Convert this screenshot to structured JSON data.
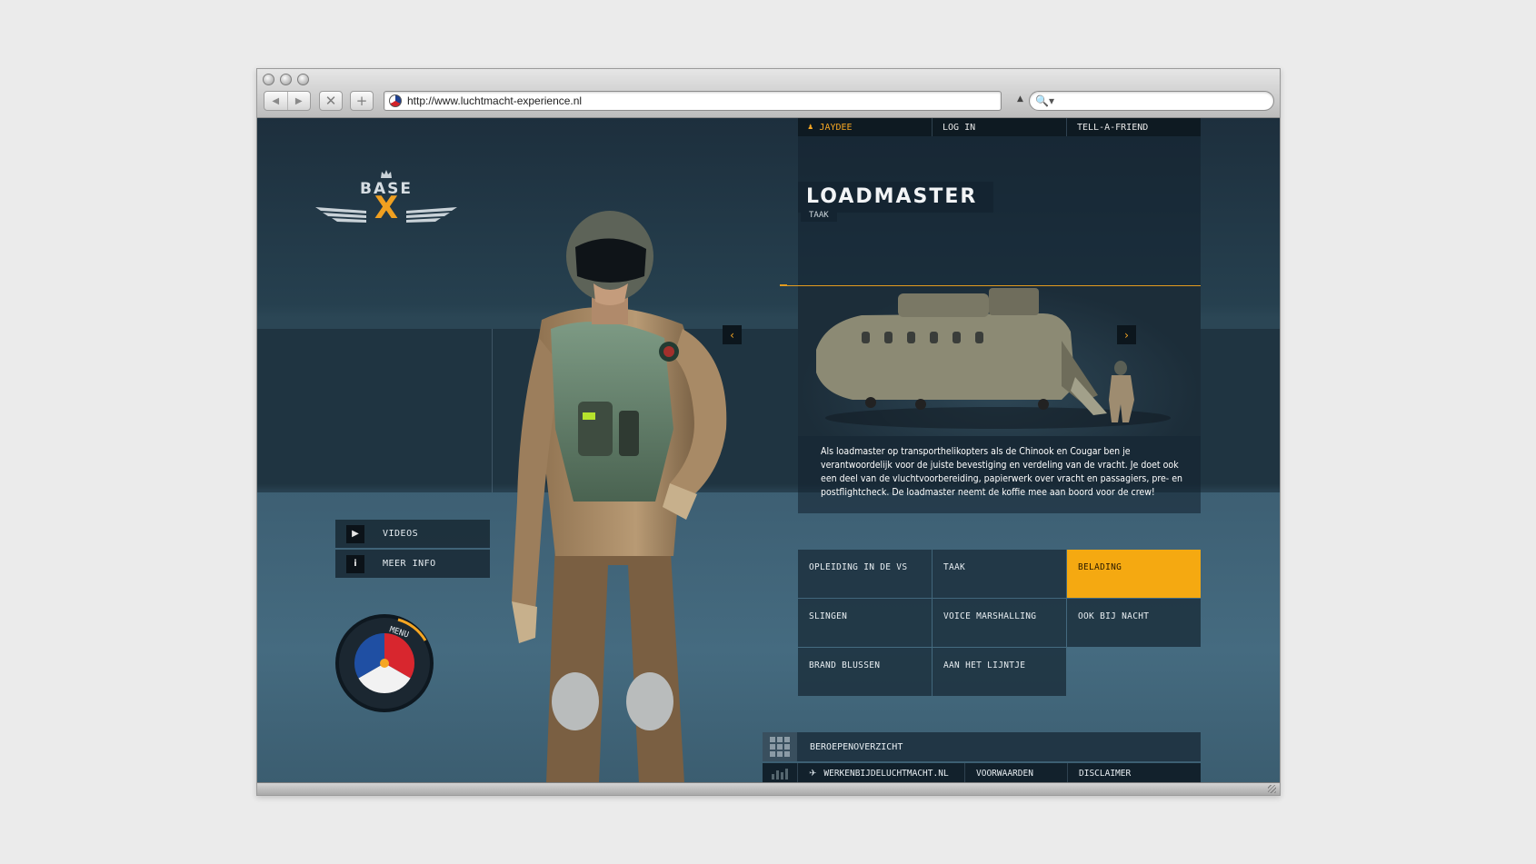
{
  "browser": {
    "url": "http://www.luchtmacht-experience.nl",
    "back_icon": "back-arrow-icon",
    "forward_icon": "forward-arrow-icon",
    "stop_label": "✕",
    "add_label": "+",
    "search_icon_label": "🔍▾"
  },
  "logo": {
    "base_text": "BASE",
    "x_text": "X"
  },
  "topnav": {
    "user_label": "JAYDEE",
    "login_label": "LOG IN",
    "tell_label": "TELL-A-FRIEND"
  },
  "job": {
    "title": "LOADMASTER",
    "subtitle": "TAAK",
    "description": "Als loadmaster op transporthelikopters als de Chinook en Cougar ben je verantwoordelijk voor de juiste bevestiging en verdeling van de vracht. Je doet ook een deel van de vluchtvoorbereiding, papierwerk over vracht en passagiers, pre- en postflightcheck. De loadmaster neemt de koffie mee aan boord voor de crew!"
  },
  "carousel": {
    "prev_label": "‹",
    "next_label": "›"
  },
  "left_menu": {
    "videos_label": "VIDEOS",
    "info_label": "MEER INFO",
    "info_icon_label": "i",
    "dial_label": "MENU"
  },
  "tasks": [
    {
      "label": "OPLEIDING IN DE VS",
      "active": false
    },
    {
      "label": "TAAK",
      "active": false
    },
    {
      "label": "BELADING",
      "active": true
    },
    {
      "label": "SLINGEN",
      "active": false
    },
    {
      "label": "VOICE MARSHALLING",
      "active": false
    },
    {
      "label": "OOK BIJ NACHT",
      "active": false
    },
    {
      "label": "BRAND BLUSSEN",
      "active": false
    },
    {
      "label": "AAN HET LIJNTJE",
      "active": false
    }
  ],
  "footer": {
    "overview_label": "BEROEPENOVERZICHT",
    "werken_label": "WERKENBIJDELUCHTMACHT.NL",
    "voorwaarden_label": "VOORWAARDEN",
    "disclaimer_label": "DISCLAIMER"
  },
  "colors": {
    "accent": "#f5a911",
    "panel": "#1e3240",
    "background": "#2b4655"
  }
}
